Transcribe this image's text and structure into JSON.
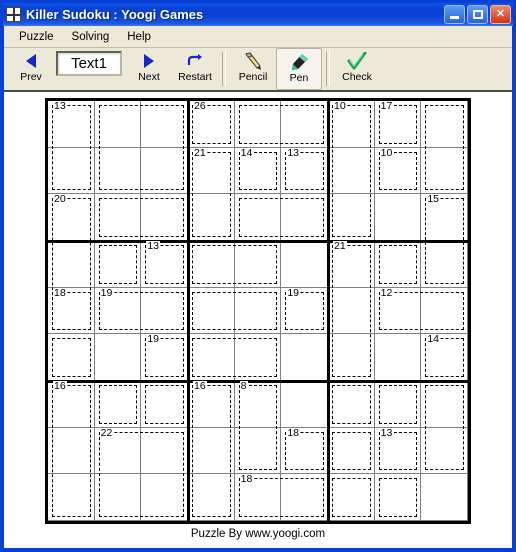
{
  "window": {
    "title": "Killer Sudoku : Yoogi Games",
    "icon": "sudoku-grid-icon",
    "buttons": [
      {
        "name": "minimize",
        "label": "_"
      },
      {
        "name": "maximize",
        "label": "□"
      },
      {
        "name": "close",
        "label": "✕"
      }
    ]
  },
  "menubar": {
    "items": [
      {
        "label": "Puzzle"
      },
      {
        "label": "Solving"
      },
      {
        "label": "Help"
      }
    ]
  },
  "toolbar": {
    "prev_label": "Prev",
    "puzzle_number": "Text1",
    "puzzle_number_placeholder": "Text1",
    "next_label": "Next",
    "restart_label": "Restart",
    "pencil_label": "Pencil",
    "pen_label": "Pen",
    "check_label": "Check",
    "active_tool": "Pen"
  },
  "footer": {
    "credit": "Puzzle By www.yoogi.com"
  },
  "board": {
    "size": 9,
    "cells": [
      [
        "",
        "",
        "",
        "",
        "",
        "",
        "",
        "",
        ""
      ],
      [
        "",
        "",
        "",
        "",
        "",
        "",
        "",
        "",
        ""
      ],
      [
        "",
        "",
        "",
        "",
        "",
        "",
        "",
        "",
        ""
      ],
      [
        "",
        "",
        "",
        "",
        "",
        "",
        "",
        "",
        ""
      ],
      [
        "",
        "",
        "",
        "",
        "",
        "",
        "",
        "",
        ""
      ],
      [
        "",
        "",
        "",
        "",
        "",
        "",
        "",
        "",
        ""
      ],
      [
        "",
        "",
        "",
        "",
        "",
        "",
        "",
        "",
        ""
      ],
      [
        "",
        "",
        "",
        "",
        "",
        "",
        "",
        "",
        ""
      ],
      [
        "",
        "",
        "",
        "",
        "",
        "",
        "",
        "",
        ""
      ]
    ],
    "cages": [
      {
        "sum": "13",
        "r": 0,
        "c": 0,
        "w": 1,
        "h": 2
      },
      {
        "sum": "",
        "r": 0,
        "c": 1,
        "w": 2,
        "h": 2
      },
      {
        "sum": "26",
        "r": 0,
        "c": 3,
        "w": 1,
        "h": 1
      },
      {
        "sum": "",
        "r": 0,
        "c": 4,
        "w": 2,
        "h": 1
      },
      {
        "sum": "10",
        "r": 0,
        "c": 6,
        "w": 1,
        "h": 3
      },
      {
        "sum": "17",
        "r": 0,
        "c": 7,
        "w": 1,
        "h": 1
      },
      {
        "sum": "",
        "r": 0,
        "c": 8,
        "w": 1,
        "h": 2
      },
      {
        "sum": "21",
        "r": 1,
        "c": 3,
        "w": 1,
        "h": 2
      },
      {
        "sum": "14",
        "r": 1,
        "c": 4,
        "w": 1,
        "h": 1
      },
      {
        "sum": "13",
        "r": 1,
        "c": 5,
        "w": 1,
        "h": 1
      },
      {
        "sum": "10",
        "r": 1,
        "c": 7,
        "w": 1,
        "h": 1
      },
      {
        "sum": "20",
        "r": 2,
        "c": 0,
        "w": 1,
        "h": 3
      },
      {
        "sum": "",
        "r": 2,
        "c": 1,
        "w": 2,
        "h": 1
      },
      {
        "sum": "",
        "r": 2,
        "c": 4,
        "w": 2,
        "h": 1
      },
      {
        "sum": "15",
        "r": 2,
        "c": 8,
        "w": 1,
        "h": 2
      },
      {
        "sum": "",
        "r": 3,
        "c": 1,
        "w": 1,
        "h": 1
      },
      {
        "sum": "13",
        "r": 3,
        "c": 2,
        "w": 1,
        "h": 1
      },
      {
        "sum": "",
        "r": 3,
        "c": 3,
        "w": 2,
        "h": 1
      },
      {
        "sum": "21",
        "r": 3,
        "c": 6,
        "w": 1,
        "h": 3
      },
      {
        "sum": "",
        "r": 3,
        "c": 7,
        "w": 1,
        "h": 1
      },
      {
        "sum": "18",
        "r": 4,
        "c": 0,
        "w": 1,
        "h": 1
      },
      {
        "sum": "19",
        "r": 4,
        "c": 1,
        "w": 2,
        "h": 1
      },
      {
        "sum": "",
        "r": 4,
        "c": 3,
        "w": 2,
        "h": 1
      },
      {
        "sum": "19",
        "r": 4,
        "c": 5,
        "w": 1,
        "h": 1
      },
      {
        "sum": "12",
        "r": 4,
        "c": 7,
        "w": 2,
        "h": 1
      },
      {
        "sum": "",
        "r": 5,
        "c": 0,
        "w": 1,
        "h": 1
      },
      {
        "sum": "19",
        "r": 5,
        "c": 2,
        "w": 1,
        "h": 1
      },
      {
        "sum": "",
        "r": 5,
        "c": 3,
        "w": 2,
        "h": 1
      },
      {
        "sum": "14",
        "r": 5,
        "c": 8,
        "w": 1,
        "h": 1
      },
      {
        "sum": "16",
        "r": 6,
        "c": 0,
        "w": 1,
        "h": 3
      },
      {
        "sum": "",
        "r": 6,
        "c": 1,
        "w": 1,
        "h": 1
      },
      {
        "sum": "",
        "r": 6,
        "c": 2,
        "w": 1,
        "h": 1
      },
      {
        "sum": "16",
        "r": 6,
        "c": 3,
        "w": 1,
        "h": 3
      },
      {
        "sum": "8",
        "r": 6,
        "c": 4,
        "w": 1,
        "h": 2
      },
      {
        "sum": "",
        "r": 6,
        "c": 6,
        "w": 1,
        "h": 1
      },
      {
        "sum": "",
        "r": 6,
        "c": 7,
        "w": 1,
        "h": 1
      },
      {
        "sum": "",
        "r": 6,
        "c": 8,
        "w": 1,
        "h": 2
      },
      {
        "sum": "22",
        "r": 7,
        "c": 1,
        "w": 2,
        "h": 2
      },
      {
        "sum": "18",
        "r": 7,
        "c": 5,
        "w": 1,
        "h": 1
      },
      {
        "sum": "",
        "r": 7,
        "c": 6,
        "w": 1,
        "h": 1
      },
      {
        "sum": "13",
        "r": 7,
        "c": 7,
        "w": 1,
        "h": 1
      },
      {
        "sum": "18",
        "r": 8,
        "c": 4,
        "w": 2,
        "h": 1
      },
      {
        "sum": "",
        "r": 8,
        "c": 6,
        "w": 1,
        "h": 1
      },
      {
        "sum": "",
        "r": 8,
        "c": 7,
        "w": 1,
        "h": 1
      }
    ]
  }
}
